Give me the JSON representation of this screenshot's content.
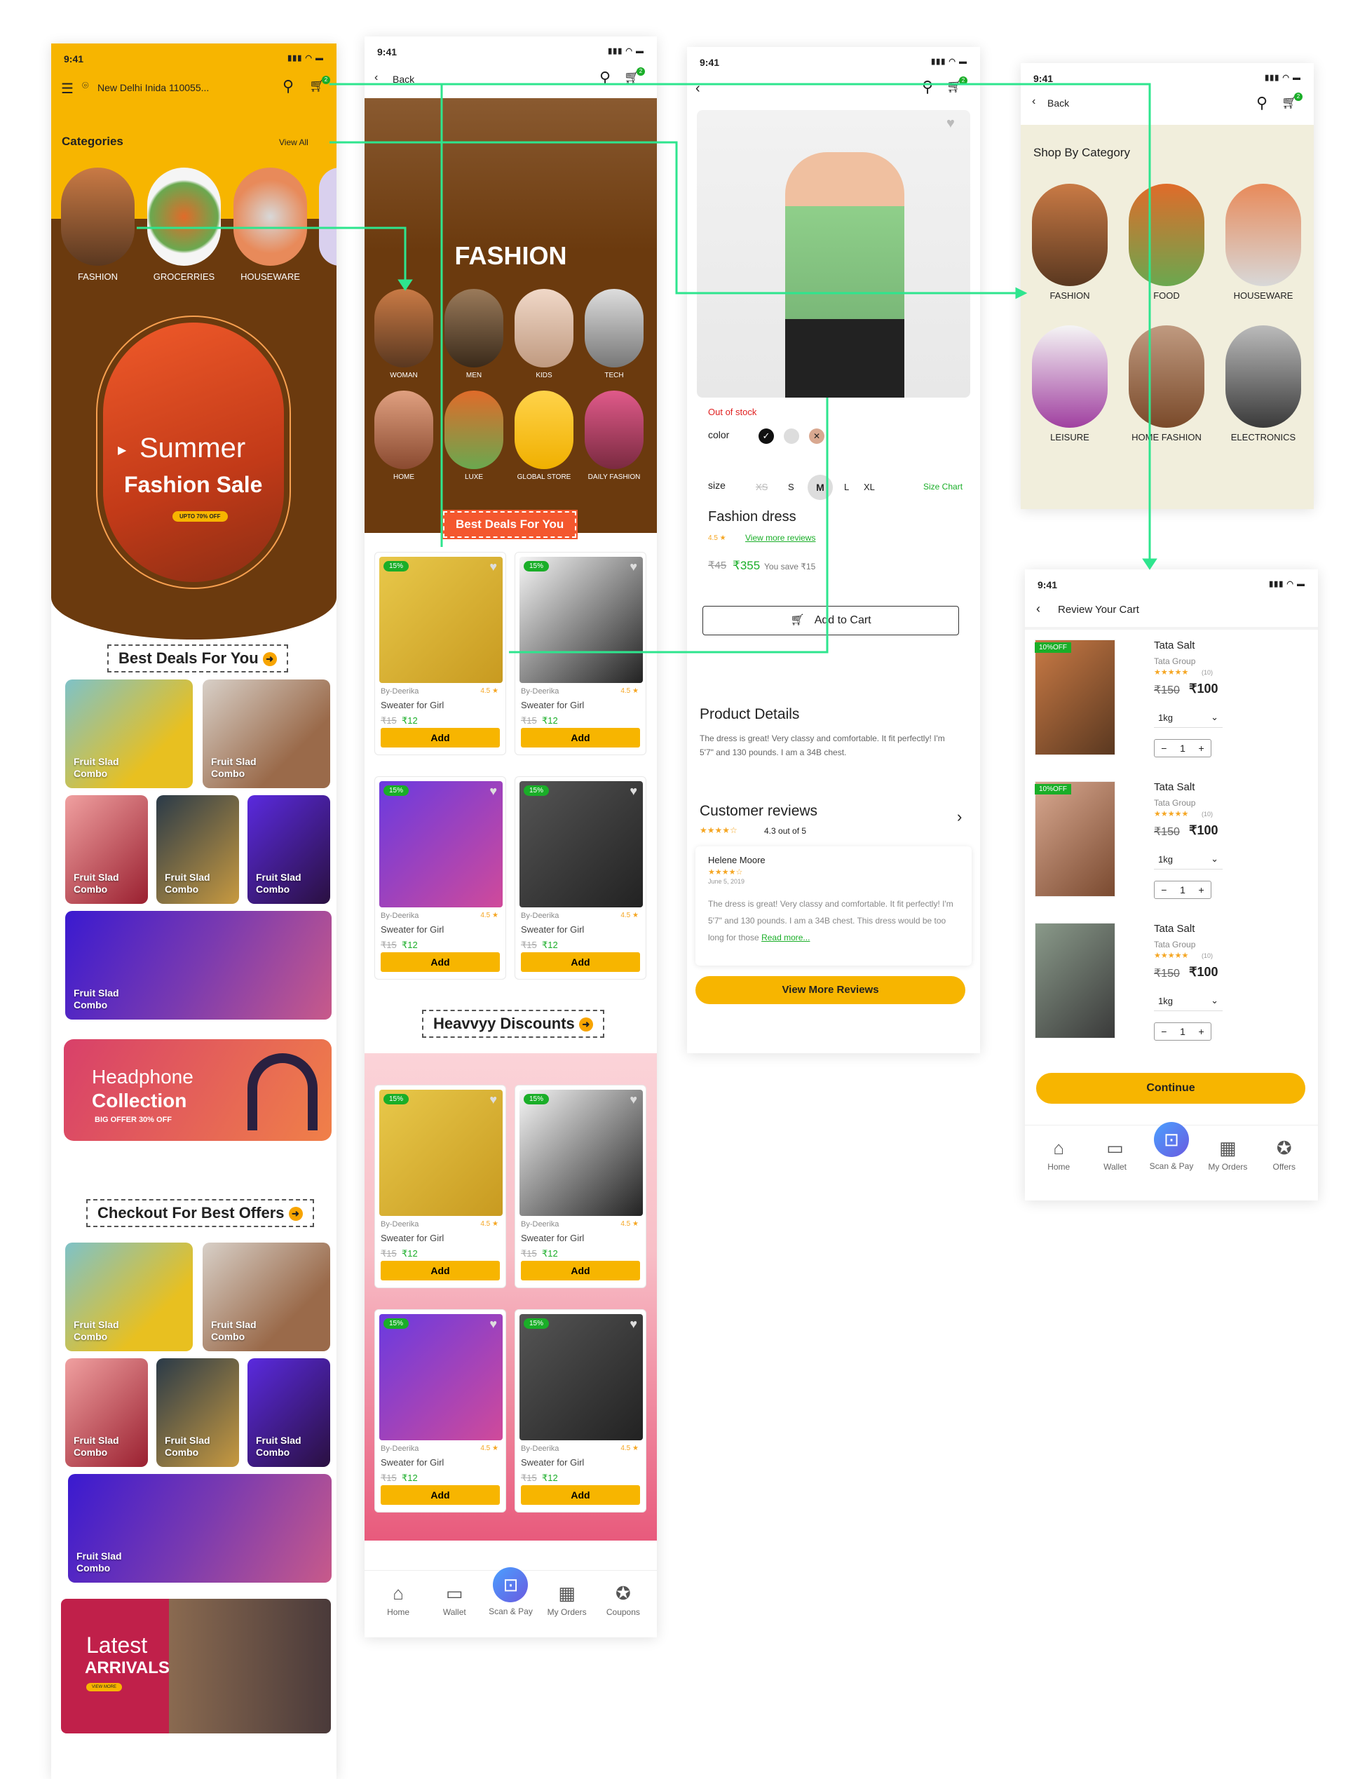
{
  "status": {
    "time": "9:41",
    "icons": "▮▮▮ ◠ ▬"
  },
  "s1": {
    "location": "New Delhi Inida 110055...",
    "categories_title": "Categories",
    "view_all": "View All",
    "categories": [
      "FASHION",
      "GROCERRIES",
      "HOUSEWARE"
    ],
    "banner_l1": "Summer",
    "banner_l2": "Fashion Sale",
    "banner_cta": "UPTO 70% OFF",
    "best_deals": "Best Deals For You",
    "tile": "Fruit Slad\nCombo",
    "headphone_t1": "Headphone",
    "headphone_t2": "Collection",
    "headphone_sub": "BIG OFFER 30% OFF",
    "checkout": "Checkout For Best Offers",
    "latest_t1": "Latest",
    "latest_t2": "ARRIVALS",
    "latest_cta": "VIEW MORE",
    "cart_badge": "2"
  },
  "s2": {
    "back": "Back",
    "cart_badge": "2",
    "hero_title": "FASHION",
    "subcats": [
      "WOMAN",
      "MEN",
      "KIDS",
      "TECH",
      "HOME",
      "LUXE",
      "GLOBAL STORE",
      "DAILY FASHION"
    ],
    "best_deals": "Best Deals For You",
    "heavy": "Heavvyy Discounts",
    "card": {
      "disc": "15%",
      "by": "By-Deerika",
      "rating": "4.5 ★",
      "name": "Sweater for Girl",
      "old": "₹15",
      "new": "₹12",
      "add": "Add"
    },
    "nav": [
      "Home",
      "Wallet",
      "Scan & Pay",
      "My Orders",
      "Coupons"
    ]
  },
  "s3": {
    "cart_badge": "2",
    "stock": "Out of stock",
    "color": "color",
    "size": "size",
    "sizes": [
      "XS",
      "S",
      "M",
      "L",
      "XL"
    ],
    "size_chart": "Size Chart",
    "title": "Fashion dress",
    "rating": "4.5 ★",
    "reviews_link": "View more reviews",
    "old": "₹45",
    "price": "₹355",
    "save": "You save ₹15",
    "add_cart": "Add to Cart",
    "details_h": "Product Details",
    "details": "The dress is great! Very classy and comfortable. It fit perfectly! I'm 5'7\" and 130 pounds. I am a 34B chest.",
    "reviews_h": "Customer reviews",
    "reviews_score": "4.3 out of 5",
    "reviewer": "Helene Moore",
    "review_date": "June 5, 2019",
    "review": "The dress is great! Very classy and comfortable. It fit perfectly! I'm 5'7\" and 130 pounds. I am a 34B chest. This dress would be too long for those",
    "read_more": "Read more...",
    "view_more": "View More Reviews"
  },
  "s4": {
    "back": "Back",
    "cart_badge": "2",
    "title": "Shop By Category",
    "cats": [
      "FASHION",
      "FOOD",
      "HOUSEWARE",
      "LEISURE",
      "HOME FASHION",
      "ELECTRONICS"
    ]
  },
  "s5": {
    "title": "Review Your Cart",
    "items": [
      {
        "off": "10%OFF",
        "name": "Tata Salt",
        "brand": "Tata Group",
        "count": "(10)",
        "old": "₹150",
        "price": "₹100",
        "qty_unit": "1kg",
        "qty": "1"
      },
      {
        "off": "10%OFF",
        "name": "Tata Salt",
        "brand": "Tata Group",
        "count": "(10)",
        "old": "₹150",
        "price": "₹100",
        "qty_unit": "1kg",
        "qty": "1"
      },
      {
        "off": "",
        "name": "Tata Salt",
        "brand": "Tata Group",
        "count": "(10)",
        "old": "₹150",
        "price": "₹100",
        "qty_unit": "1kg",
        "qty": "1"
      }
    ],
    "continue": "Continue",
    "nav": [
      "Home",
      "Wallet",
      "Scan & Pay",
      "My Orders",
      "Offers"
    ]
  },
  "colors": {
    "yellow": "#f7b500",
    "brown": "#6b3a0e",
    "green": "#1aae28",
    "link": "#2ee58e"
  }
}
